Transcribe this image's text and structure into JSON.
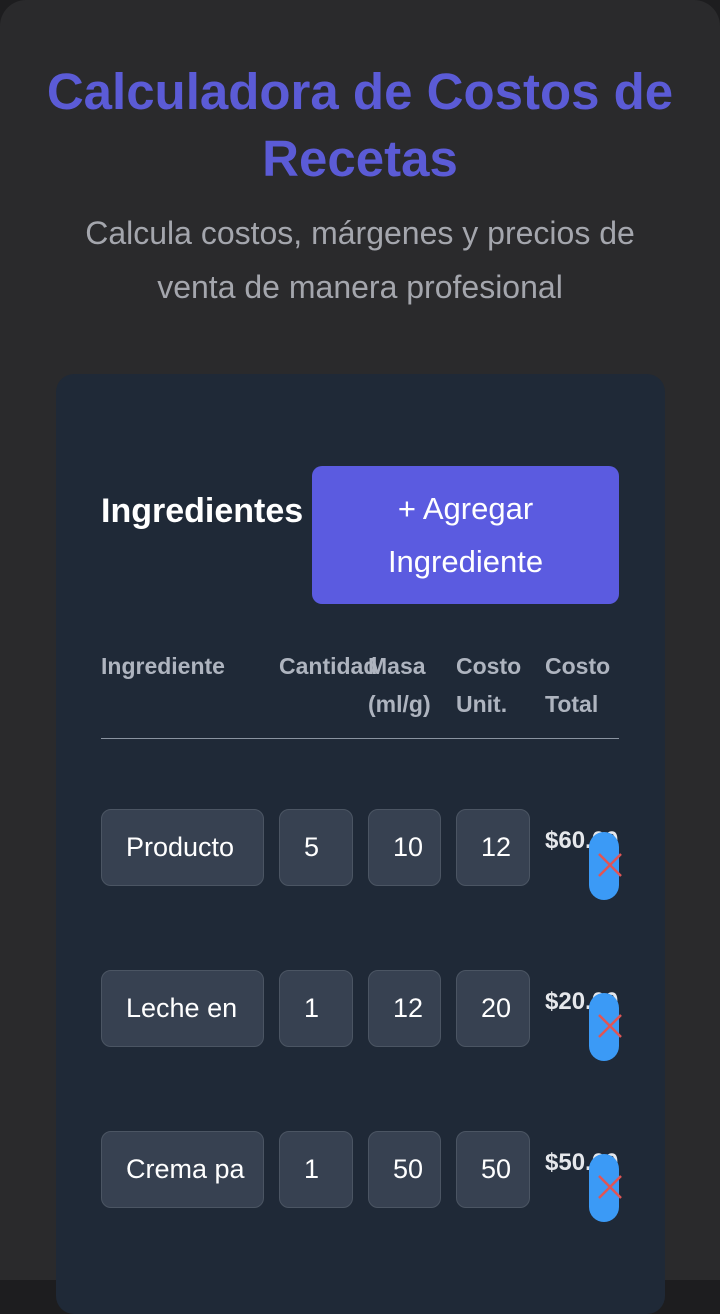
{
  "header": {
    "title": "Calculadora de Costos de Recetas",
    "subtitle": "Calcula costos, márgenes y precios de venta de manera profesional"
  },
  "ingredients": {
    "section_title": "Ingredientes",
    "add_button_label": "+ Agregar Ingrediente",
    "columns": [
      "Ingrediente",
      "Cantidad",
      "Masa (ml/g)",
      "Costo Unit.",
      "Costo Total"
    ],
    "rows": [
      {
        "name": "Producto",
        "quantity": "5",
        "mass": "10",
        "unit_cost": "12",
        "total": "$60.00"
      },
      {
        "name": "Leche en",
        "quantity": "1",
        "mass": "12",
        "unit_cost": "20",
        "total": "$20.00"
      },
      {
        "name": "Crema pa",
        "quantity": "1",
        "mass": "50",
        "unit_cost": "50",
        "total": "$50.00"
      }
    ]
  },
  "colors": {
    "accent": "#5b5bd6",
    "button": "#5b5be0",
    "card": "#1f2937",
    "delete": "#3b9af6",
    "delete_icon": "#e05555"
  },
  "icons": {
    "delete": "close-icon"
  }
}
